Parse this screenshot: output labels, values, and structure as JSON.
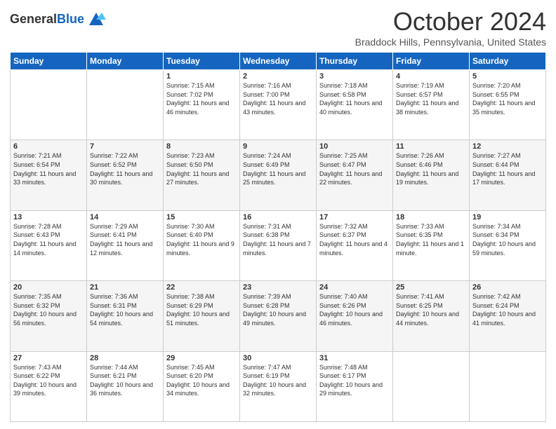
{
  "header": {
    "logo_line1": "General",
    "logo_line2": "Blue",
    "month": "October 2024",
    "location": "Braddock Hills, Pennsylvania, United States"
  },
  "weekdays": [
    "Sunday",
    "Monday",
    "Tuesday",
    "Wednesday",
    "Thursday",
    "Friday",
    "Saturday"
  ],
  "weeks": [
    [
      {
        "day": "",
        "sunrise": "",
        "sunset": "",
        "daylight": ""
      },
      {
        "day": "",
        "sunrise": "",
        "sunset": "",
        "daylight": ""
      },
      {
        "day": "1",
        "sunrise": "Sunrise: 7:15 AM",
        "sunset": "Sunset: 7:02 PM",
        "daylight": "Daylight: 11 hours and 46 minutes."
      },
      {
        "day": "2",
        "sunrise": "Sunrise: 7:16 AM",
        "sunset": "Sunset: 7:00 PM",
        "daylight": "Daylight: 11 hours and 43 minutes."
      },
      {
        "day": "3",
        "sunrise": "Sunrise: 7:18 AM",
        "sunset": "Sunset: 6:58 PM",
        "daylight": "Daylight: 11 hours and 40 minutes."
      },
      {
        "day": "4",
        "sunrise": "Sunrise: 7:19 AM",
        "sunset": "Sunset: 6:57 PM",
        "daylight": "Daylight: 11 hours and 38 minutes."
      },
      {
        "day": "5",
        "sunrise": "Sunrise: 7:20 AM",
        "sunset": "Sunset: 6:55 PM",
        "daylight": "Daylight: 11 hours and 35 minutes."
      }
    ],
    [
      {
        "day": "6",
        "sunrise": "Sunrise: 7:21 AM",
        "sunset": "Sunset: 6:54 PM",
        "daylight": "Daylight: 11 hours and 33 minutes."
      },
      {
        "day": "7",
        "sunrise": "Sunrise: 7:22 AM",
        "sunset": "Sunset: 6:52 PM",
        "daylight": "Daylight: 11 hours and 30 minutes."
      },
      {
        "day": "8",
        "sunrise": "Sunrise: 7:23 AM",
        "sunset": "Sunset: 6:50 PM",
        "daylight": "Daylight: 11 hours and 27 minutes."
      },
      {
        "day": "9",
        "sunrise": "Sunrise: 7:24 AM",
        "sunset": "Sunset: 6:49 PM",
        "daylight": "Daylight: 11 hours and 25 minutes."
      },
      {
        "day": "10",
        "sunrise": "Sunrise: 7:25 AM",
        "sunset": "Sunset: 6:47 PM",
        "daylight": "Daylight: 11 hours and 22 minutes."
      },
      {
        "day": "11",
        "sunrise": "Sunrise: 7:26 AM",
        "sunset": "Sunset: 6:46 PM",
        "daylight": "Daylight: 11 hours and 19 minutes."
      },
      {
        "day": "12",
        "sunrise": "Sunrise: 7:27 AM",
        "sunset": "Sunset: 6:44 PM",
        "daylight": "Daylight: 11 hours and 17 minutes."
      }
    ],
    [
      {
        "day": "13",
        "sunrise": "Sunrise: 7:28 AM",
        "sunset": "Sunset: 6:43 PM",
        "daylight": "Daylight: 11 hours and 14 minutes."
      },
      {
        "day": "14",
        "sunrise": "Sunrise: 7:29 AM",
        "sunset": "Sunset: 6:41 PM",
        "daylight": "Daylight: 11 hours and 12 minutes."
      },
      {
        "day": "15",
        "sunrise": "Sunrise: 7:30 AM",
        "sunset": "Sunset: 6:40 PM",
        "daylight": "Daylight: 11 hours and 9 minutes."
      },
      {
        "day": "16",
        "sunrise": "Sunrise: 7:31 AM",
        "sunset": "Sunset: 6:38 PM",
        "daylight": "Daylight: 11 hours and 7 minutes."
      },
      {
        "day": "17",
        "sunrise": "Sunrise: 7:32 AM",
        "sunset": "Sunset: 6:37 PM",
        "daylight": "Daylight: 11 hours and 4 minutes."
      },
      {
        "day": "18",
        "sunrise": "Sunrise: 7:33 AM",
        "sunset": "Sunset: 6:35 PM",
        "daylight": "Daylight: 11 hours and 1 minute."
      },
      {
        "day": "19",
        "sunrise": "Sunrise: 7:34 AM",
        "sunset": "Sunset: 6:34 PM",
        "daylight": "Daylight: 10 hours and 59 minutes."
      }
    ],
    [
      {
        "day": "20",
        "sunrise": "Sunrise: 7:35 AM",
        "sunset": "Sunset: 6:32 PM",
        "daylight": "Daylight: 10 hours and 56 minutes."
      },
      {
        "day": "21",
        "sunrise": "Sunrise: 7:36 AM",
        "sunset": "Sunset: 6:31 PM",
        "daylight": "Daylight: 10 hours and 54 minutes."
      },
      {
        "day": "22",
        "sunrise": "Sunrise: 7:38 AM",
        "sunset": "Sunset: 6:29 PM",
        "daylight": "Daylight: 10 hours and 51 minutes."
      },
      {
        "day": "23",
        "sunrise": "Sunrise: 7:39 AM",
        "sunset": "Sunset: 6:28 PM",
        "daylight": "Daylight: 10 hours and 49 minutes."
      },
      {
        "day": "24",
        "sunrise": "Sunrise: 7:40 AM",
        "sunset": "Sunset: 6:26 PM",
        "daylight": "Daylight: 10 hours and 46 minutes."
      },
      {
        "day": "25",
        "sunrise": "Sunrise: 7:41 AM",
        "sunset": "Sunset: 6:25 PM",
        "daylight": "Daylight: 10 hours and 44 minutes."
      },
      {
        "day": "26",
        "sunrise": "Sunrise: 7:42 AM",
        "sunset": "Sunset: 6:24 PM",
        "daylight": "Daylight: 10 hours and 41 minutes."
      }
    ],
    [
      {
        "day": "27",
        "sunrise": "Sunrise: 7:43 AM",
        "sunset": "Sunset: 6:22 PM",
        "daylight": "Daylight: 10 hours and 39 minutes."
      },
      {
        "day": "28",
        "sunrise": "Sunrise: 7:44 AM",
        "sunset": "Sunset: 6:21 PM",
        "daylight": "Daylight: 10 hours and 36 minutes."
      },
      {
        "day": "29",
        "sunrise": "Sunrise: 7:45 AM",
        "sunset": "Sunset: 6:20 PM",
        "daylight": "Daylight: 10 hours and 34 minutes."
      },
      {
        "day": "30",
        "sunrise": "Sunrise: 7:47 AM",
        "sunset": "Sunset: 6:19 PM",
        "daylight": "Daylight: 10 hours and 32 minutes."
      },
      {
        "day": "31",
        "sunrise": "Sunrise: 7:48 AM",
        "sunset": "Sunset: 6:17 PM",
        "daylight": "Daylight: 10 hours and 29 minutes."
      },
      {
        "day": "",
        "sunrise": "",
        "sunset": "",
        "daylight": ""
      },
      {
        "day": "",
        "sunrise": "",
        "sunset": "",
        "daylight": ""
      }
    ]
  ]
}
